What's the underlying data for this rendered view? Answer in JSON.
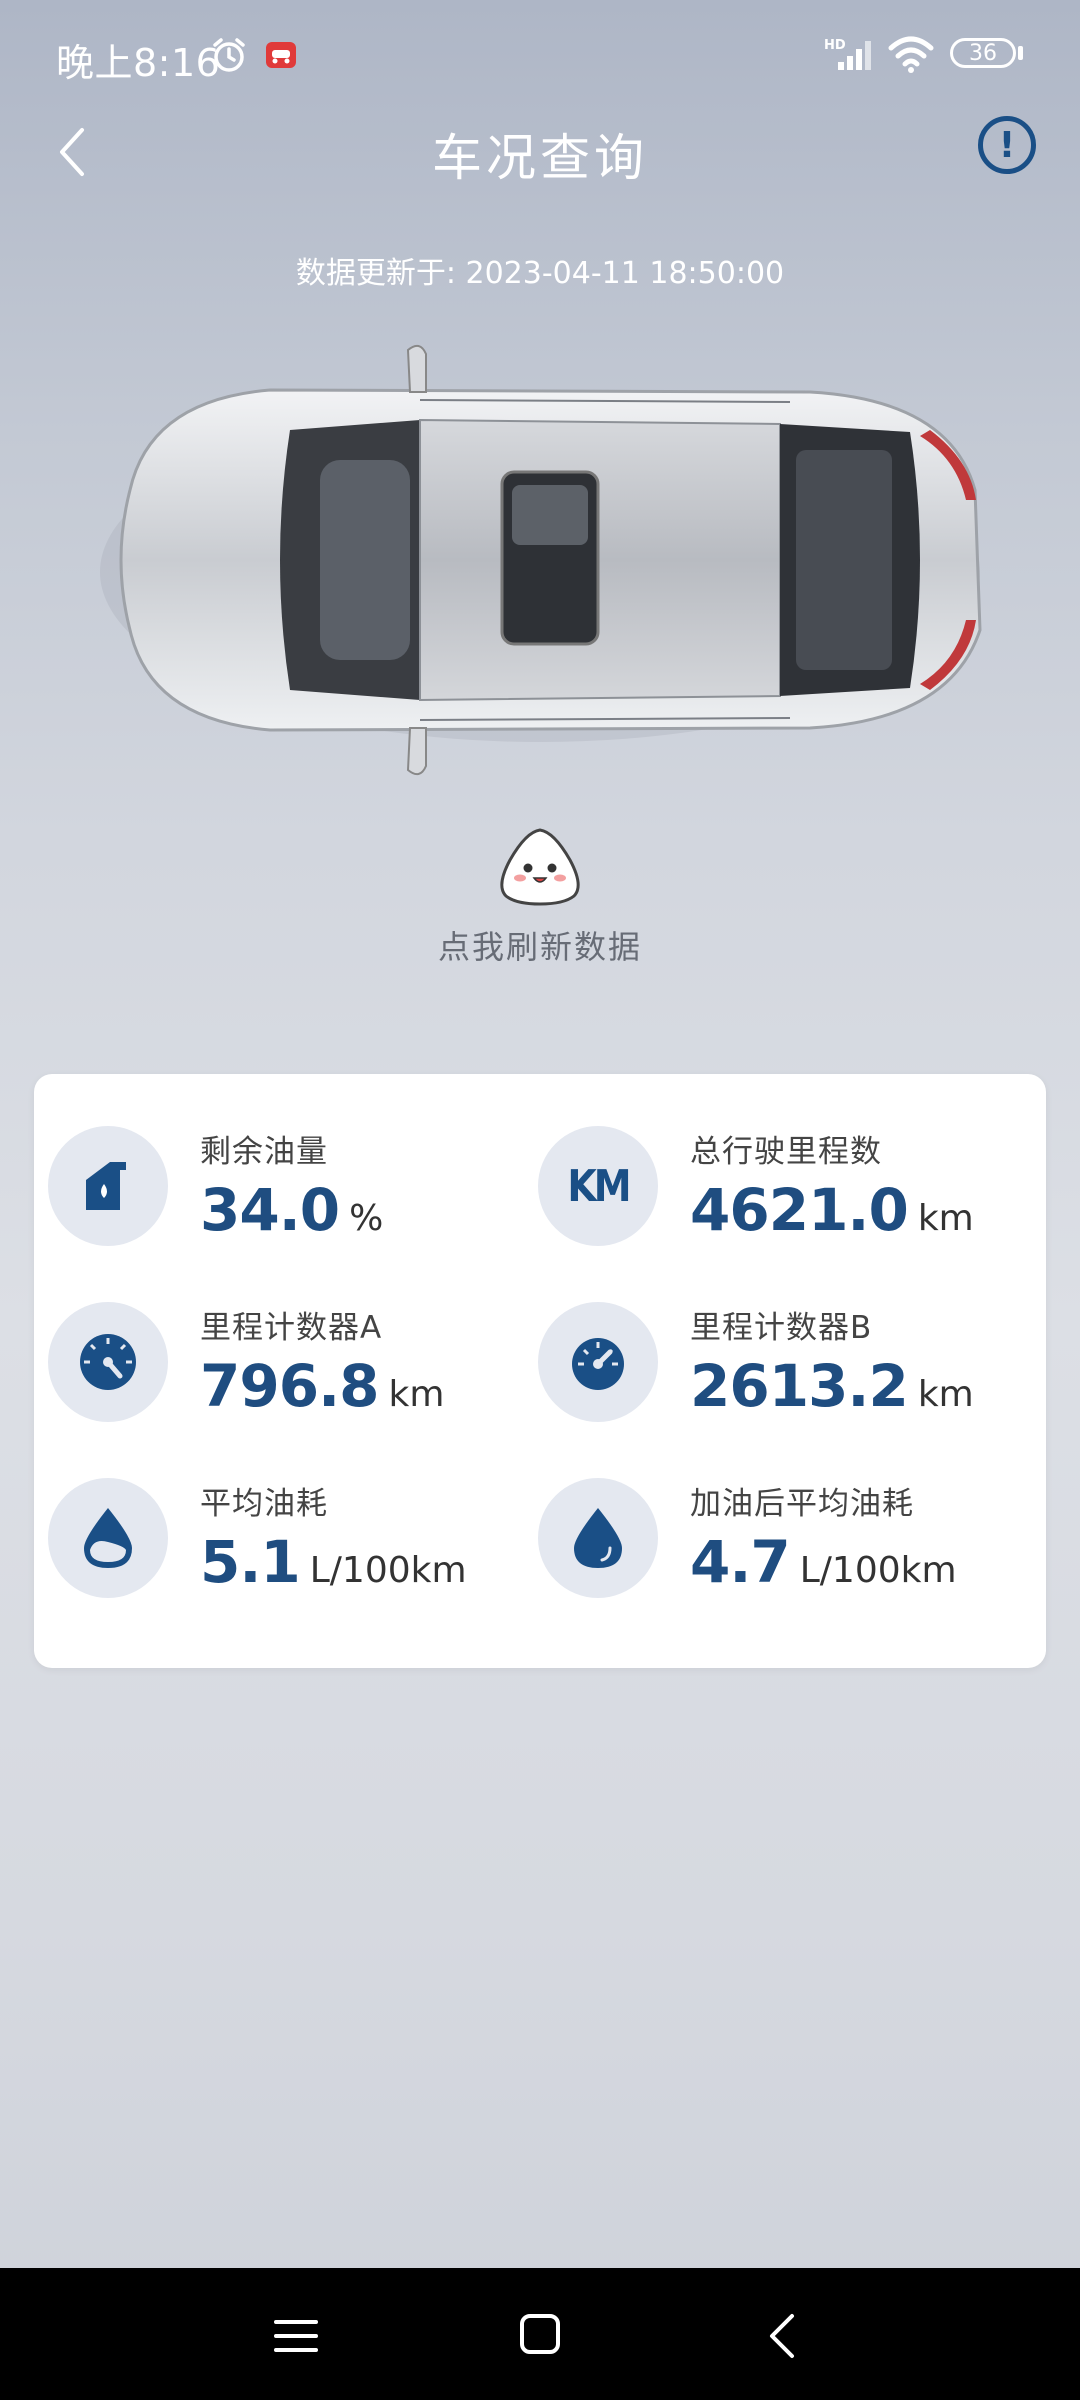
{
  "status_bar": {
    "time": "晚上8:16",
    "battery": "36",
    "icons": [
      "alarm-icon",
      "app-notification-icon",
      "hd-signal-icon",
      "wifi-icon",
      "battery-icon"
    ]
  },
  "header": {
    "title": "车况查询"
  },
  "update_time": "数据更新于: 2023-04-11 18:50:00",
  "refresh": {
    "label": "点我刷新数据"
  },
  "stats": [
    {
      "label": "剩余油量",
      "value": "34.0",
      "unit": "%",
      "icon": "fuel-tank-icon"
    },
    {
      "label": "总行驶里程数",
      "value": "4621.0",
      "unit": "km",
      "icon": "km-icon"
    },
    {
      "label": "里程计数器A",
      "value": "796.8",
      "unit": "km",
      "icon": "odometer-a-icon"
    },
    {
      "label": "里程计数器B",
      "value": "2613.2",
      "unit": "km",
      "icon": "odometer-b-icon"
    },
    {
      "label": "平均油耗",
      "value": "5.1",
      "unit": "L/100km",
      "icon": "fuel-drop-half-icon"
    },
    {
      "label": "加油后平均油耗",
      "value": "4.7",
      "unit": "L/100km",
      "icon": "fuel-drop-icon"
    }
  ],
  "km_icon_text": "KM",
  "colors": {
    "accent": "#1f4d80",
    "icon_bg": "#e4e8f0",
    "nav_bar": "#000000"
  }
}
